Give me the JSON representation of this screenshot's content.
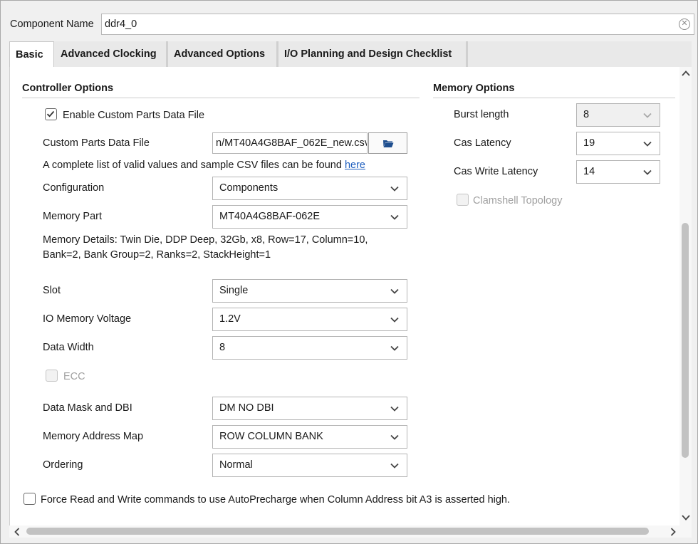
{
  "component": {
    "label": "Component Name",
    "value": "ddr4_0"
  },
  "tabs": [
    {
      "label": "Basic",
      "active": true
    },
    {
      "label": "Advanced Clocking",
      "active": false
    },
    {
      "label": "Advanced Options",
      "active": false
    },
    {
      "label": "I/O Planning and Design Checklist",
      "active": false
    }
  ],
  "controller": {
    "title": "Controller Options",
    "enable_custom": {
      "label": "Enable Custom Parts Data File",
      "checked": true
    },
    "custom_file": {
      "label": "Custom Parts Data File",
      "value": "n/MT40A4G8BAF_062E_new.csv"
    },
    "info_text": "A complete list of valid values and sample CSV files can be found",
    "info_link": "here",
    "configuration": {
      "label": "Configuration",
      "value": "Components"
    },
    "memory_part": {
      "label": "Memory Part",
      "value": "MT40A4G8BAF-062E"
    },
    "memory_details_line1": "Memory Details: Twin Die, DDP Deep, 32Gb, x8, Row=17, Column=10,",
    "memory_details_line2": "Bank=2, Bank Group=2, Ranks=2, StackHeight=1",
    "slot": {
      "label": "Slot",
      "value": "Single"
    },
    "io_voltage": {
      "label": "IO Memory Voltage",
      "value": "1.2V"
    },
    "data_width": {
      "label": "Data Width",
      "value": "8"
    },
    "ecc": {
      "label": "ECC",
      "checked": false,
      "disabled": true
    },
    "data_mask": {
      "label": "Data Mask and DBI",
      "value": "DM NO DBI"
    },
    "address_map": {
      "label": "Memory Address Map",
      "value": "ROW COLUMN BANK"
    },
    "ordering": {
      "label": "Ordering",
      "value": "Normal"
    },
    "force_autoprecharge": {
      "label": "Force Read and Write commands to use AutoPrecharge when Column Address bit A3 is asserted high.",
      "checked": false
    }
  },
  "memory": {
    "title": "Memory Options",
    "burst_length": {
      "label": "Burst length",
      "value": "8",
      "disabled": true
    },
    "cas_latency": {
      "label": "Cas Latency",
      "value": "19"
    },
    "cas_write_latency": {
      "label": "Cas Write Latency",
      "value": "14"
    },
    "clamshell": {
      "label": "Clamshell Topology",
      "checked": false,
      "disabled": true
    }
  },
  "colors": {
    "link": "#1f5fbf",
    "disabled_text": "#a0a0a0",
    "panel_bg": "#f0f0f0"
  }
}
